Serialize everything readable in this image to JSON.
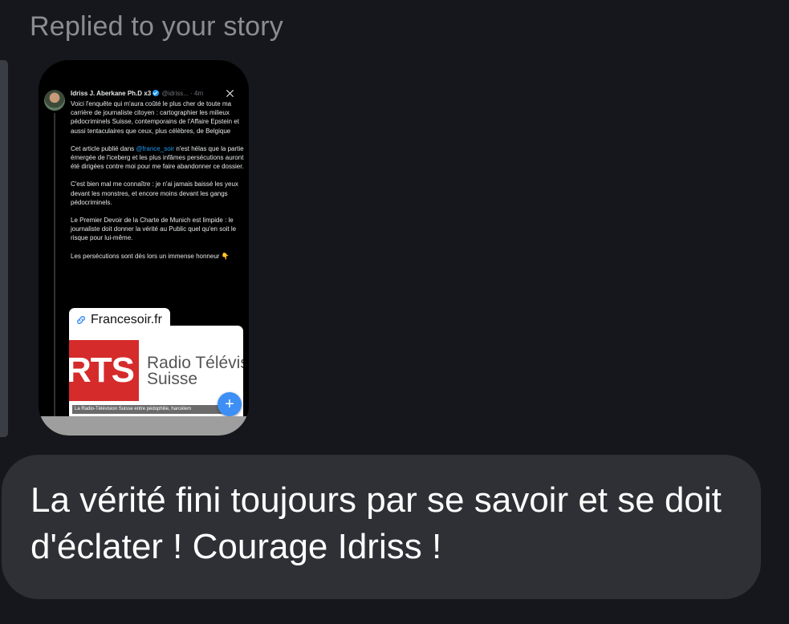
{
  "header": {
    "reply_label": "Replied to your story"
  },
  "story": {
    "tweet": {
      "author_name": "Idriss J. Aberkane Ph.D x3",
      "handle_time": "@idriss... · 4m",
      "paragraphs": [
        "Voici l'enquête qui m'aura coûté le plus cher de toute ma carrière de journaliste citoyen : cartographier les milieux pédocriminels Suisse, contemporains de l'Affaire Epstein et aussi tentaculaires que ceux, plus célèbres, de Belgique",
        "n'est hélas que la partie émergée de l'iceberg et les plus infâmes persécutions auront été dirigées contre moi pour me faire abandonner ce dossier.",
        "C'est bien mal me connaître : je n'ai jamais baissé les yeux devant les monstres, et encore moins devant les gangs pédocriminels.",
        "Le Premier Devoir de la Charte de Munich est limpide : le journaliste doit donner la vérité au Public quel qu'en soit le risque pour lui-même.",
        "Les persécutions sont dès lors un immense honneur 👇"
      ],
      "para2_prefix": "Cet article publié dans ",
      "mention": "@france_soir",
      "link_chip_label": "Francesoir.fr",
      "preview_logo_text": "RTS",
      "preview_name_line1": "Radio Télévis",
      "preview_name_line2": "Suisse",
      "preview_caption": "La Radio-Télévision Suisse entre pédophilie, harcèlem"
    }
  },
  "message": {
    "text": "La vérité fini toujours par se savoir et se doit d'éclater ! Courage Idriss !"
  },
  "colors": {
    "background": "#15171c",
    "bubble": "#2e3035",
    "header_text": "#8a8d93",
    "accent_blue": "#1d9bf0",
    "rts_red": "#d52b2b"
  }
}
